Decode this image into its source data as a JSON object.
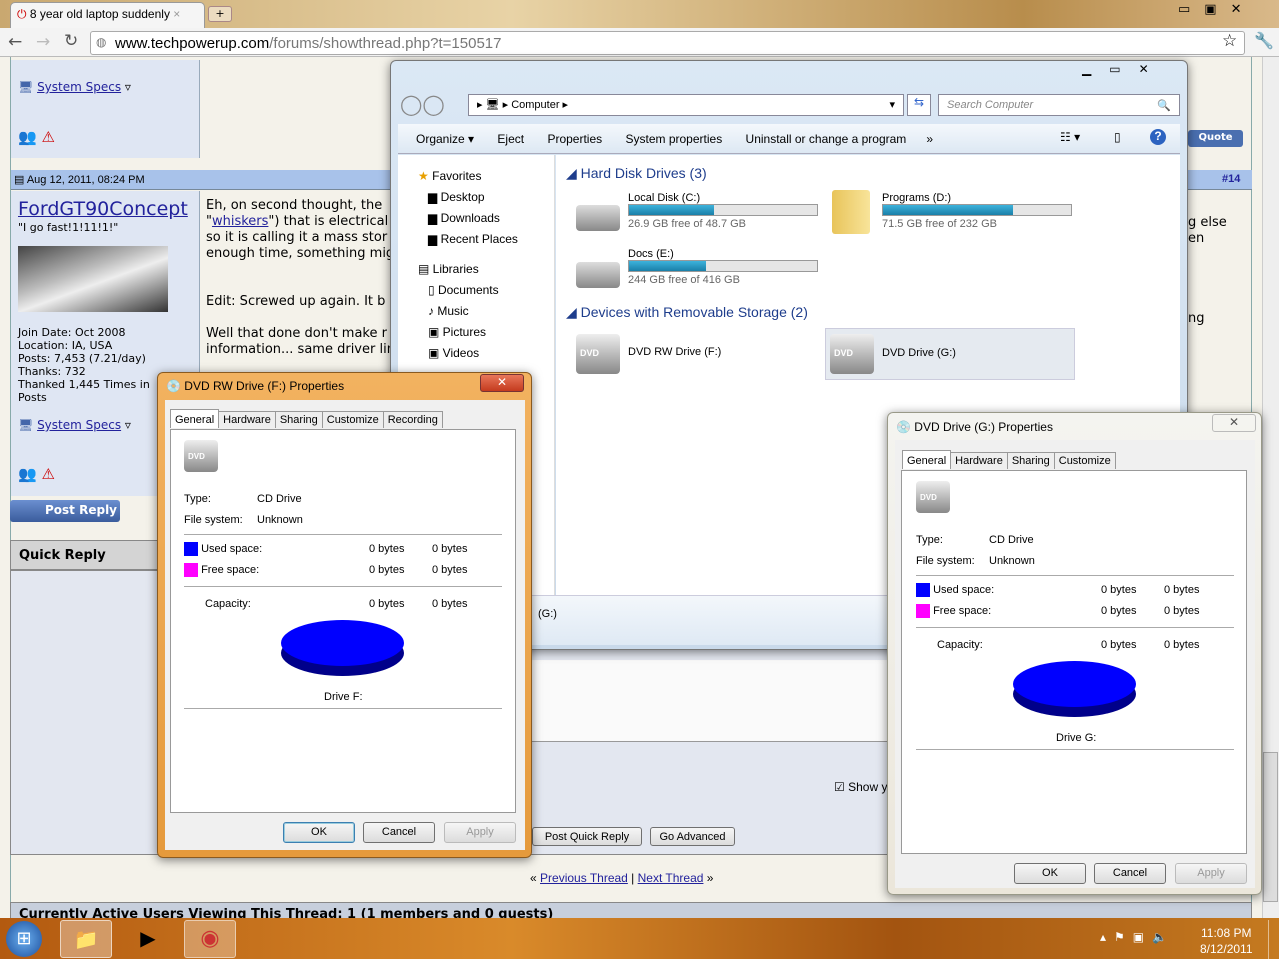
{
  "browser": {
    "tab_title": "8 year old laptop suddenly",
    "url_domain": "www.techpowerup.com",
    "url_path": "/forums/showthread.php?t=150517"
  },
  "forum": {
    "system_specs": "System Specs",
    "post_date": "Aug 12, 2011, 08:24 PM",
    "post_number": "#14",
    "username": "FordGT90Concept",
    "user_title": "\"I go fast!1!11!1!\"",
    "user_info": [
      "Join Date: Oct 2008",
      "Location: IA, USA",
      "Posts: 7,453 (7.21/day)",
      "Thanks: 732",
      "Thanked 1,445 Times in",
      "Posts"
    ],
    "post_lines": [
      "Eh, on second thought, the",
      "\") that is electrical",
      "so it is calling it a mass stor",
      "enough time, something mig",
      "Edit: Screwed up again. It b",
      "Well that done don't make r",
      "information... same driver lin"
    ],
    "whiskers_link": "whiskers",
    "right_fragments": [
      "g else",
      "en",
      "ng"
    ],
    "quote_button": "Quote",
    "post_reply": "Post Reply",
    "quick_reply": "Quick Reply",
    "show_checkbox": "Show y",
    "post_quick_reply": "Post Quick Reply",
    "go_advanced": "Go Advanced",
    "prev_thread": "Previous Thread",
    "next_thread": "Next Thread",
    "active_users": "Currently Active Users Viewing This Thread: 1 (1 members and 0 guests)"
  },
  "explorer": {
    "breadcrumb": "Computer",
    "search_placeholder": "Search Computer",
    "toolbar": [
      "Organize ▾",
      "Eject",
      "Properties",
      "System properties",
      "Uninstall or change a program",
      "»"
    ],
    "nav": {
      "favorites": "Favorites",
      "fav_items": [
        "Desktop",
        "Downloads",
        "Recent Places"
      ],
      "libraries": "Libraries",
      "lib_items": [
        "Documents",
        "Music",
        "Pictures",
        "Videos"
      ]
    },
    "hdd_header": "Hard Disk Drives (3)",
    "drives": [
      {
        "name": "Local Disk (C:)",
        "free": "26.9 GB free of 48.7 GB",
        "used_pct": 45
      },
      {
        "name": "Programs (D:)",
        "free": "71.5 GB free of 232 GB",
        "used_pct": 69
      },
      {
        "name": "Docs (E:)",
        "free": "244 GB free of 416 GB",
        "used_pct": 41
      }
    ],
    "removable_header": "Devices with Removable Storage (2)",
    "removable": [
      "DVD RW Drive (F:)",
      "DVD Drive (G:)"
    ],
    "details": "(G:)"
  },
  "dialog_f": {
    "title": "DVD RW Drive (F:) Properties",
    "tabs": [
      "General",
      "Hardware",
      "Sharing",
      "Customize",
      "Recording"
    ],
    "drive_label": "Drive F:"
  },
  "dialog_g": {
    "title": "DVD Drive (G:) Properties",
    "tabs": [
      "General",
      "Hardware",
      "Sharing",
      "Customize"
    ],
    "drive_label": "Drive G:"
  },
  "props": {
    "type_label": "Type:",
    "type_value": "CD Drive",
    "fs_label": "File system:",
    "fs_value": "Unknown",
    "used_label": "Used space:",
    "free_label": "Free space:",
    "cap_label": "Capacity:",
    "bytes": "0 bytes",
    "ok": "OK",
    "cancel": "Cancel",
    "apply": "Apply",
    "used_color": "#0000ff",
    "free_color": "#ff00ff"
  },
  "taskbar": {
    "time": "11:08 PM",
    "date": "8/12/2011"
  }
}
